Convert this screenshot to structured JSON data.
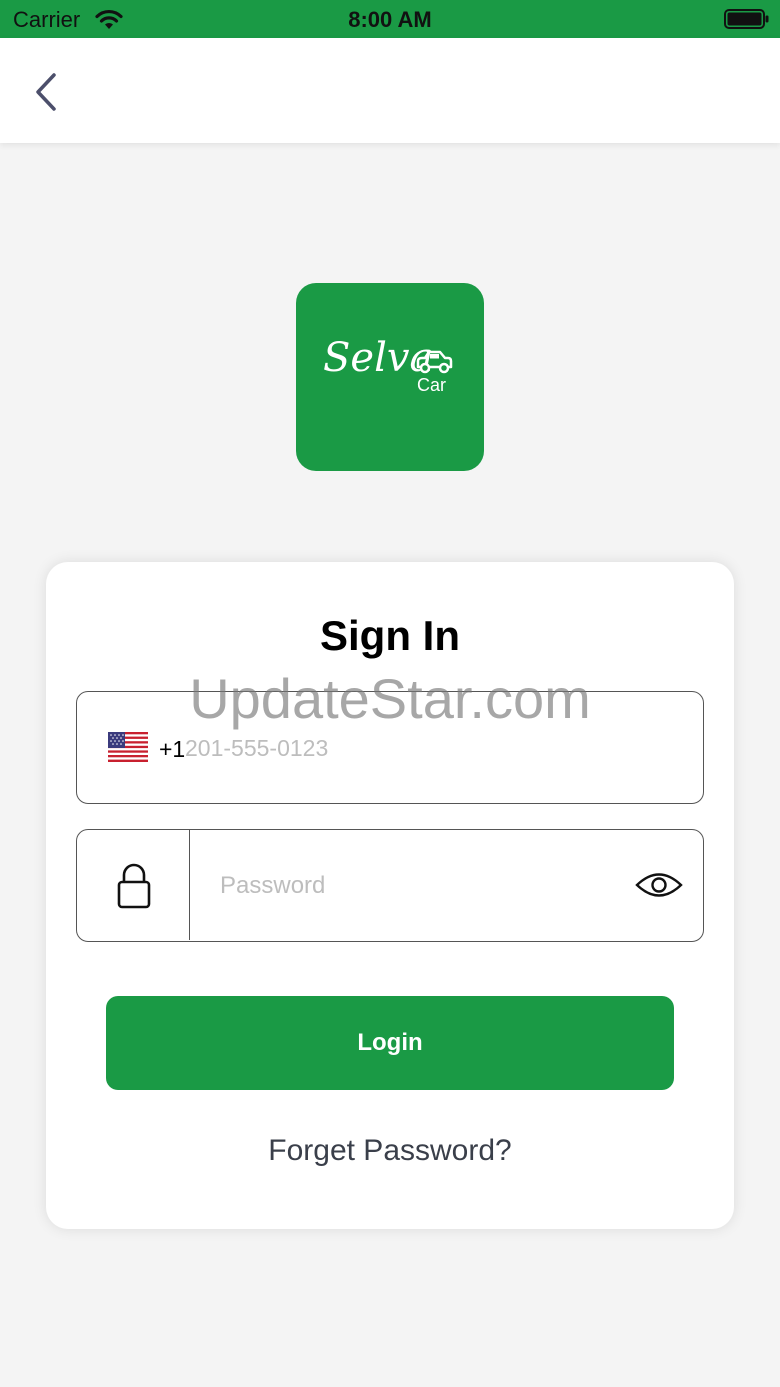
{
  "status_bar": {
    "carrier": "Carrier",
    "time": "8:00 AM"
  },
  "nav": {
    "back_icon": "chevron-left-icon"
  },
  "logo": {
    "script_text": "Selva",
    "sub_text": "Car"
  },
  "sign_in": {
    "title": "Sign In",
    "watermark": "UpdateStar.com",
    "phone": {
      "country_flag": "us-flag-icon",
      "dial_code": "+1",
      "placeholder": "201-555-0123"
    },
    "password": {
      "placeholder": "Password",
      "lock_icon": "lock-icon",
      "toggle_icon": "eye-icon"
    },
    "login_label": "Login",
    "forget_label": "Forget Password?"
  },
  "colors": {
    "brand_green": "#1a9a45",
    "background": "#f4f4f4",
    "card": "#ffffff",
    "placeholder": "#bdbdbd",
    "link_text": "#3a3f4a"
  }
}
